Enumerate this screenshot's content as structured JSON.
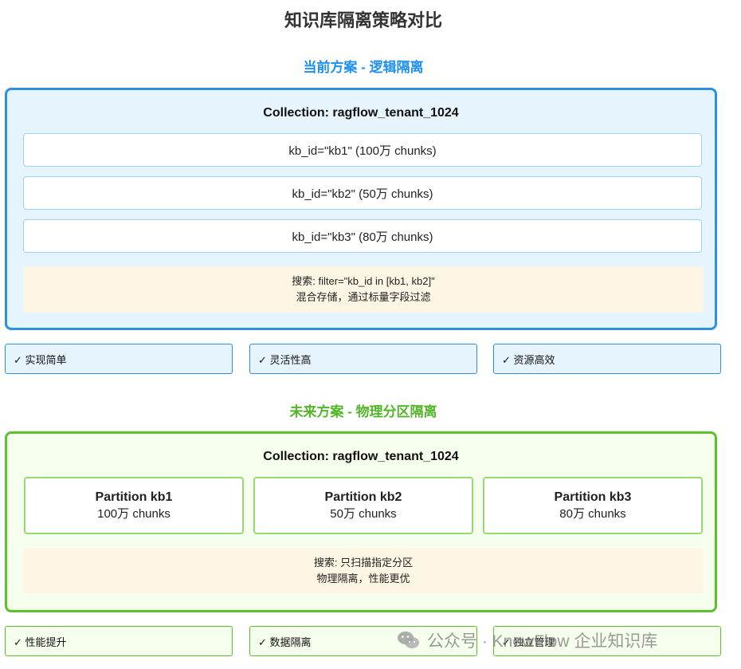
{
  "title": "知识库隔离策略对比",
  "current": {
    "heading": "当前方案 - 逻辑隔离",
    "collection": "Collection: ragflow_tenant_1024",
    "kb_rows": [
      "kb_id=\"kb1\" (100万 chunks)",
      "kb_id=\"kb2\" (50万 chunks)",
      "kb_id=\"kb3\" (80万 chunks)"
    ],
    "search_line1": "搜索: filter=\"kb_id in [kb1, kb2]\"",
    "search_line2": "混合存储，通过标量字段过滤",
    "benefits": [
      "✓ 实现简单",
      "✓ 灵活性高",
      "✓ 资源高效"
    ]
  },
  "future": {
    "heading": "未来方案 - 物理分区隔离",
    "collection": "Collection: ragflow_tenant_1024",
    "partitions": [
      {
        "name": "Partition kb1",
        "chunks": "100万 chunks"
      },
      {
        "name": "Partition kb2",
        "chunks": "50万 chunks"
      },
      {
        "name": "Partition kb3",
        "chunks": "80万 chunks"
      }
    ],
    "search_line1": "搜索: 只扫描指定分区",
    "search_line2": "物理隔离，性能更优",
    "benefits": [
      "✓ 性能提升",
      "✓ 数据隔离",
      "✓ 独立管理"
    ]
  },
  "watermark": {
    "icon": "wechat-icon",
    "text": "公众号 · KnowFlow 企业知识库"
  },
  "colors": {
    "blue_accent": "#2e8fe3",
    "blue_fill": "#e6f4fd",
    "green_accent": "#5cc22c",
    "green_fill": "#f6ffed",
    "search_fill": "#fdf6e4"
  }
}
